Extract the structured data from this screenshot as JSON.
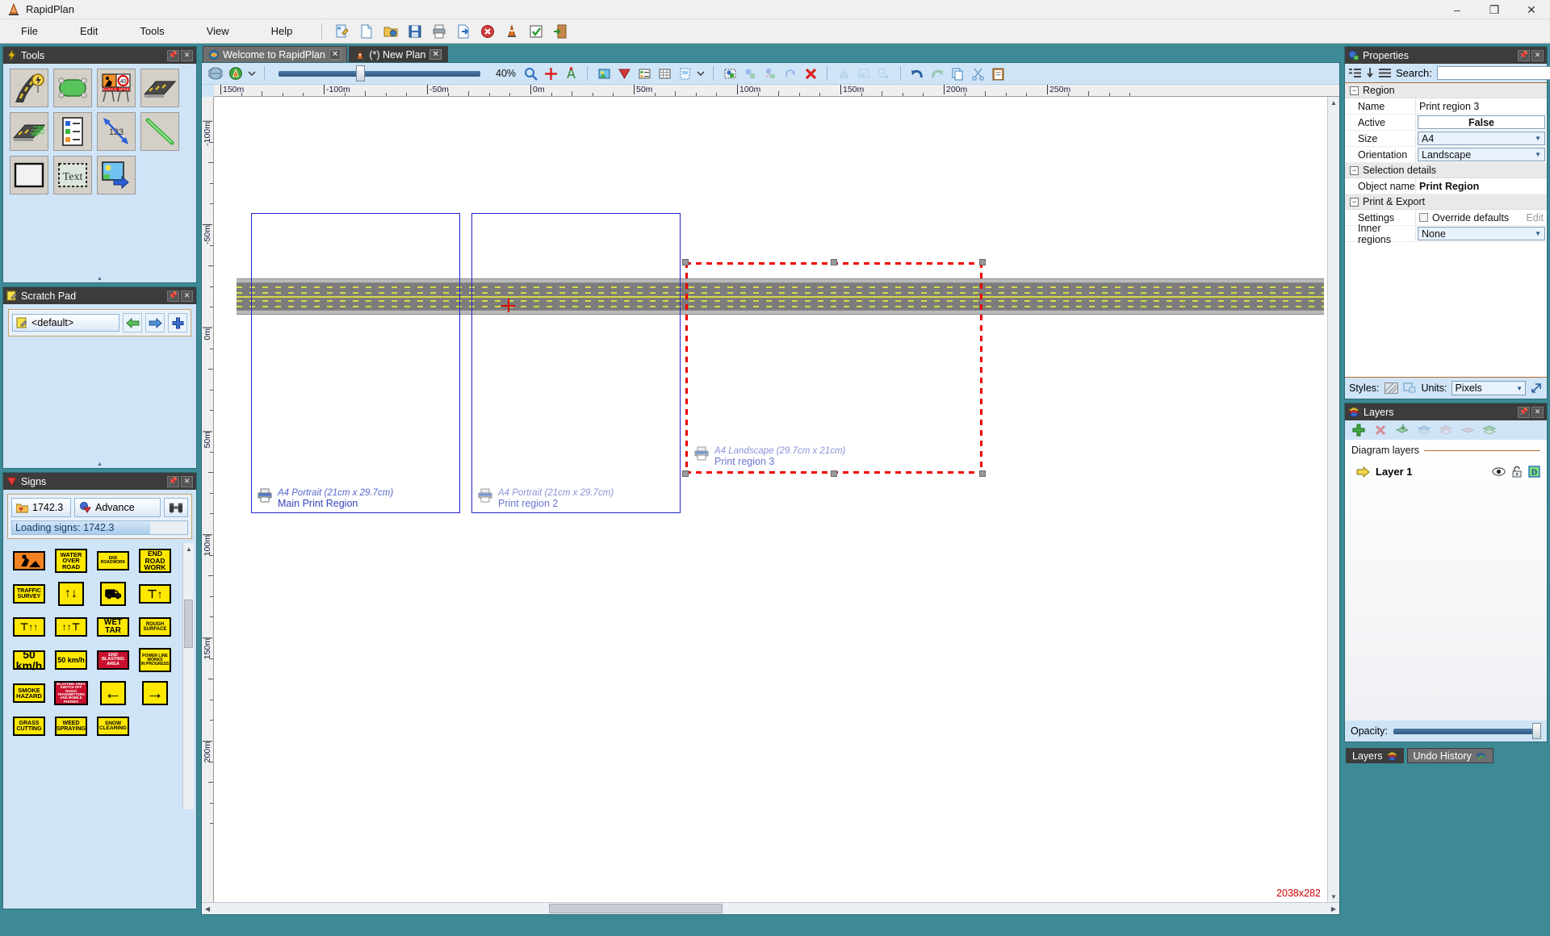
{
  "window": {
    "title": "RapidPlan",
    "minimize": "–",
    "maximize": "❐",
    "close": "✕"
  },
  "menubar": {
    "items": [
      "File",
      "Edit",
      "Tools",
      "View",
      "Help"
    ],
    "toolbar_icons": [
      "new-plan-icon",
      "new-document-icon",
      "open-folder-icon",
      "save-icon",
      "print-icon",
      "export-icon",
      "close-plan-icon",
      "traffic-cone-icon",
      "validate-icon",
      "exit-icon"
    ]
  },
  "tools_panel": {
    "title": "Tools",
    "pin_icon": "pin-icon",
    "close_icon": "close-icon",
    "items": [
      {
        "name": "road-tool",
        "icon": "road-with-sign-icon"
      },
      {
        "name": "area-tool",
        "icon": "green-area-icon"
      },
      {
        "name": "sign-board-tool",
        "icon": "reduce-speed-board-icon"
      },
      {
        "name": "road-segment-tool",
        "icon": "road-segment-icon"
      },
      {
        "name": "hatching-tool",
        "icon": "road-hatching-icon"
      },
      {
        "name": "legend-tool",
        "icon": "legend-list-icon"
      },
      {
        "name": "dimension-tool",
        "icon": "dimension-arrow-123-icon"
      },
      {
        "name": "line-tool",
        "icon": "green-line-icon"
      },
      {
        "name": "rectangle-tool",
        "icon": "rectangle-icon"
      },
      {
        "name": "text-tool",
        "icon": "text-box-icon"
      },
      {
        "name": "image-tool",
        "icon": "insert-image-icon"
      }
    ]
  },
  "scratch_pad": {
    "title": "Scratch Pad",
    "selected": "<default>",
    "combo_icon": "notepad-icon",
    "prev_icon": "green-left-arrow-icon",
    "next_icon": "blue-right-arrow-icon",
    "add_icon": "blue-plus-icon"
  },
  "signs_panel": {
    "title": "Signs",
    "library_label": "1742.3",
    "library_icon": "folder-signs-icon",
    "category_label": "Advance",
    "category_icon": "sign-category-icon",
    "search_icon": "binoculars-icon",
    "progress_text": "Loading signs: 1742.3",
    "progress_percent": 79,
    "signs": [
      {
        "name": "roadworks-symbol-sign",
        "lines": [
          "WORKER"
        ],
        "kind": "orange-symbol",
        "fs": 7
      },
      {
        "name": "water-over-road-sign",
        "lines": [
          "WATER",
          "OVER",
          "ROAD"
        ],
        "kind": "yellow",
        "fs": 7.5
      },
      {
        "name": "end-roadwork-sign",
        "lines": [
          "END",
          "ROADWORK"
        ],
        "kind": "yellow",
        "fs": 5
      },
      {
        "name": "end-road-work-sign",
        "lines": [
          "END",
          "ROAD",
          "WORK"
        ],
        "kind": "yellow",
        "fs": 8.5
      },
      {
        "name": "traffic-survey-sign",
        "lines": [
          "TRAFFIC",
          "SURVEY"
        ],
        "kind": "yellow",
        "fs": 7
      },
      {
        "name": "two-way-arrows-sign",
        "lines": [
          "↑↓"
        ],
        "kind": "yellow",
        "fs": 16
      },
      {
        "name": "truck-symbol-sign",
        "lines": [
          "⛟"
        ],
        "kind": "yellow",
        "fs": 17
      },
      {
        "name": "lane-merge-right-sign",
        "lines": [
          "⊤↑"
        ],
        "kind": "yellow",
        "fs": 14
      },
      {
        "name": "lane-closed-left-sign",
        "lines": [
          "⊤↑↑"
        ],
        "kind": "yellow",
        "fs": 12
      },
      {
        "name": "lane-closed-right-sign",
        "lines": [
          "↑↑⊤"
        ],
        "kind": "yellow",
        "fs": 12
      },
      {
        "name": "wet-tar-sign",
        "lines": [
          "WET",
          "TAR"
        ],
        "kind": "yellow",
        "fs": 10
      },
      {
        "name": "rough-surface-cyclist-sign",
        "lines": [
          "ROUGH",
          "SURFACE"
        ],
        "kind": "yellow",
        "fs": 6
      },
      {
        "name": "speed-50-kmh-sign",
        "lines": [
          "50",
          "km/h"
        ],
        "kind": "yellow",
        "fs": 14
      },
      {
        "name": "speed-50-kmh-small-sign",
        "lines": [
          "50 km/h"
        ],
        "kind": "yellow",
        "fs": 9
      },
      {
        "name": "end-blasting-area-sign",
        "lines": [
          "END",
          "BLASTING  AREA"
        ],
        "kind": "red",
        "fs": 5.5
      },
      {
        "name": "power-line-works-sign",
        "lines": [
          "POWER  LINE",
          "WORKS",
          "IN  PROGRESS"
        ],
        "kind": "yellow",
        "fs": 5
      },
      {
        "name": "smoke-hazard-sign",
        "lines": [
          "SMOKE",
          "HAZARD"
        ],
        "kind": "yellow",
        "fs": 7.5
      },
      {
        "name": "blasting-area-radio-sign",
        "lines": [
          "BLASTING AREA",
          "SWITCH OFF RADIO",
          "TRANSMITTERS",
          "AND MOBILE PHONES"
        ],
        "kind": "red",
        "fs": 4.3
      },
      {
        "name": "left-arrow-sign",
        "lines": [
          "←"
        ],
        "kind": "yellow",
        "fs": 22
      },
      {
        "name": "right-arrow-sign",
        "lines": [
          "→"
        ],
        "kind": "yellow",
        "fs": 22
      },
      {
        "name": "grass-cutting-sign",
        "lines": [
          "GRASS",
          "CUTTING"
        ],
        "kind": "yellow",
        "fs": 7
      },
      {
        "name": "weed-spraying-sign",
        "lines": [
          "WEED",
          "SPRAYING"
        ],
        "kind": "yellow",
        "fs": 7
      },
      {
        "name": "snow-clearing-sign",
        "lines": [
          "SNOW",
          "CLEARING"
        ],
        "kind": "yellow",
        "fs": 6.5
      }
    ]
  },
  "tabs": [
    {
      "label": "Welcome to RapidPlan",
      "icon": "welcome-icon",
      "active": false,
      "close": "✕"
    },
    {
      "label": "(*) New Plan",
      "icon": "traffic-cone-icon",
      "active": true,
      "close": "✕"
    }
  ],
  "canvas_toolbar": {
    "globe_icon": "globe-icon",
    "onsite_icon": "onsite-mode-icon",
    "dropdown_icon": "chevron-down-icon",
    "zoom_value": "40%",
    "zoom_percent": 40,
    "magnifier_icon": "magnifier-icon",
    "crosshair_icon": "red-crosshair-icon",
    "antenna_icon": "survey-marker-icon",
    "icons_group_2": [
      "image-layer-icon",
      "signs-filter-icon",
      "legend-icon",
      "table-icon",
      "page-setup-icon",
      "chevron-down-icon"
    ],
    "icons_group_3": [
      "select-object-icon",
      "group-icon",
      "ungroup-icon",
      "rotate-icon",
      "delete-icon"
    ],
    "icons_group_4": [
      "mirror-icon",
      "align-icon",
      "distribute-icon"
    ],
    "icons_group_5": [
      "undo-icon",
      "redo-icon",
      "copy-icon",
      "cut-icon",
      "paste-icon"
    ]
  },
  "rulers": {
    "horizontal": [
      "150m",
      "-100m",
      "-50m",
      "0m",
      "50m",
      "100m",
      "150m",
      "200m",
      "250m"
    ],
    "vertical": [
      "-100m",
      "-50m",
      "0m",
      "50m",
      "100m",
      "150m",
      "200m"
    ]
  },
  "canvas": {
    "coordinate_readout": "2038x282",
    "print_regions": [
      {
        "name": "main-print-region",
        "size_label": "A4 Portrait (21cm x 29.7cm)",
        "label": "Main Print Region",
        "printer_icon": "printer-icon",
        "selected": false,
        "dimmed": false
      },
      {
        "name": "print-region-2",
        "size_label": "A4 Portrait (21cm x 29.7cm)",
        "label": "Print region 2",
        "printer_icon": "printer-icon",
        "selected": false,
        "dimmed": true
      },
      {
        "name": "print-region-3",
        "size_label": "A4 Landscape (29.7cm x 21cm)",
        "label": "Print region 3",
        "printer_icon": "printer-icon",
        "selected": true,
        "dimmed": true
      }
    ]
  },
  "properties": {
    "title": "Properties",
    "search_label": "Search:",
    "search_value": "",
    "toolbar_icons": [
      "categorize-icon",
      "sort-descending-icon",
      "list-icon"
    ],
    "groups": [
      {
        "name": "Region",
        "rows": [
          {
            "key": "Name",
            "value": "Print region 3",
            "type": "text"
          },
          {
            "key": "Active",
            "value": "False",
            "type": "boxed"
          },
          {
            "key": "Size",
            "value": "A4",
            "type": "combo"
          },
          {
            "key": "Orientation",
            "value": "Landscape",
            "type": "combo"
          }
        ]
      },
      {
        "name": "Selection details",
        "rows": [
          {
            "key": "Object name",
            "value": "Print Region",
            "type": "bold"
          }
        ]
      },
      {
        "name": "Print & Export",
        "rows": [
          {
            "key": "Settings",
            "value": "Override defaults",
            "type": "checkbox",
            "extra": "Edit",
            "checked": false
          },
          {
            "key": "Inner regions",
            "value": "None",
            "type": "combo"
          }
        ]
      }
    ],
    "footer": {
      "styles_label": "Styles:",
      "style_icons": [
        "hatch-style-icon",
        "shape-style-icon"
      ],
      "units_label": "Units:",
      "units_value": "Pixels",
      "expand_icon": "expand-icon"
    }
  },
  "layers": {
    "title": "Layers",
    "toolbar_icons": [
      "add-layer-icon",
      "delete-layer-icon",
      "import-layer-icon",
      "move-layer-up-icon",
      "move-layer-down-icon",
      "merge-layer-icon",
      "duplicate-layer-icon"
    ],
    "section_label": "Diagram layers",
    "rows": [
      {
        "name": "Layer 1",
        "active_icon": "yellow-arrow-icon",
        "visible_icon": "eye-icon",
        "lock_icon": "unlocked-icon",
        "diagram_icon": "diagram-d-icon"
      }
    ],
    "opacity_label": "Opacity:",
    "opacity_percent": 100
  },
  "bottom_tabs": [
    {
      "label": "Layers",
      "icon": "layers-icon",
      "active": true
    },
    {
      "label": "Undo History",
      "icon": "undo-history-icon",
      "active": false
    }
  ]
}
